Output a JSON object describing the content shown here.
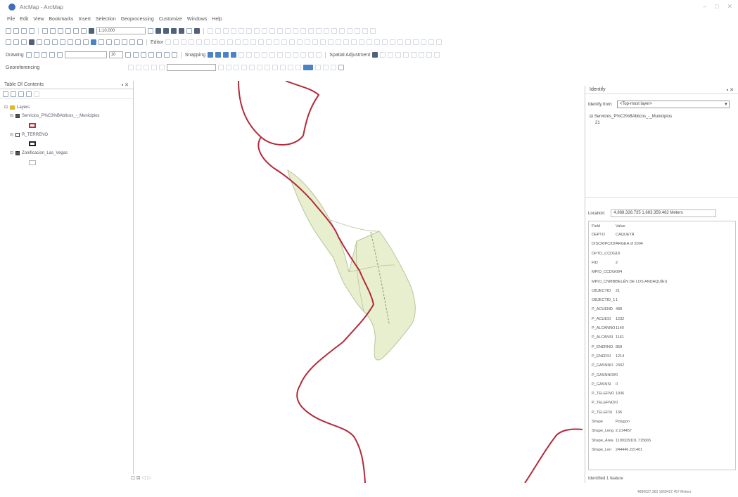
{
  "window": {
    "title": "ArcMap - ArcMap"
  },
  "menu": [
    "File",
    "Edit",
    "View",
    "Bookmarks",
    "Insert",
    "Selection",
    "Geoprocessing",
    "Customize",
    "Windows",
    "Help"
  ],
  "toolbar": {
    "scale": "1:10,000",
    "drawing_label": "Drawing",
    "font_size": "10",
    "editor_label": "Editor",
    "snapping_label": "Snapping",
    "georef_label": "Georeferencing",
    "spatial_adj_label": "Spatial Adjustment"
  },
  "toc": {
    "title": "Table Of Contents",
    "root_label": "Layers",
    "layers": [
      {
        "name": "Servicios_P%C3%BAblicos_-_Municipios",
        "checked": true,
        "symbol": "red"
      },
      {
        "name": "R_TERRENO",
        "checked": false,
        "symbol": "black"
      },
      {
        "name": "Zonificacion_Las_Vegas",
        "checked": true,
        "symbol": "light"
      }
    ]
  },
  "map": {
    "footer": "口 目 ◁ ▷"
  },
  "identify": {
    "title": "Identify",
    "from_label": "Identify from:",
    "from_value": "<Top-most layer>",
    "tree_item": "Servicios_P%C3%BAblicos_-_Municipios",
    "tree_sub": "21",
    "location_label": "Location:",
    "location_value": "4,868,328.735  1,663,359.482 Meters",
    "field_header": "Field",
    "value_header": "Value",
    "attributes": [
      {
        "f": "DEPTO",
        "v": "CAQUETÁ"
      },
      {
        "f": "DISCRIPCION",
        "v": "ARGEA of 2004"
      },
      {
        "f": "DPTO_CCDGO",
        "v": "18"
      },
      {
        "f": "FID",
        "v": "2"
      },
      {
        "f": "MPIO_CCDGO",
        "v": "094"
      },
      {
        "f": "MPIO_CNMBR",
        "v": "BELÉN DE LOS ANDAQUÍES"
      },
      {
        "f": "OBJECTID",
        "v": "21"
      },
      {
        "f": "OBJECTID_1",
        "v": "1"
      },
      {
        "f": "P_ACUEND",
        "v": "488"
      },
      {
        "f": "P_ACUESI",
        "v": "1232"
      },
      {
        "f": "P_ALCANNO",
        "v": "1140"
      },
      {
        "f": "P_ALCANSI",
        "v": "1161"
      },
      {
        "f": "P_ENERNO",
        "v": "858"
      },
      {
        "f": "P_ENERSI",
        "v": "1214"
      },
      {
        "f": "P_GASNNO",
        "v": "2302"
      },
      {
        "f": "P_GASNNOIN",
        "v": "0"
      },
      {
        "f": "P_GASNSI",
        "v": "0"
      },
      {
        "f": "P_TELEFNO",
        "v": "1936"
      },
      {
        "f": "P_TELEFNOIN",
        "v": "0"
      },
      {
        "f": "P_TELEFSI",
        "v": "136"
      },
      {
        "f": "Shape",
        "v": "Polygon"
      },
      {
        "f": "Shape_Leng",
        "v": "2.214457"
      },
      {
        "f": "Shape_Area",
        "v": "1199339101.715665"
      },
      {
        "f": "Shape_Len",
        "v": "244446.221401"
      }
    ],
    "status": "Identified 1 feature"
  },
  "statusbar": {
    "coords": "4880027.363  1660427.457 Meters"
  },
  "colors": {
    "river": "#b32a3b",
    "polygon_fill": "#e7efce",
    "polygon_stroke": "#b8c49c",
    "selection": "#4b82c8"
  }
}
